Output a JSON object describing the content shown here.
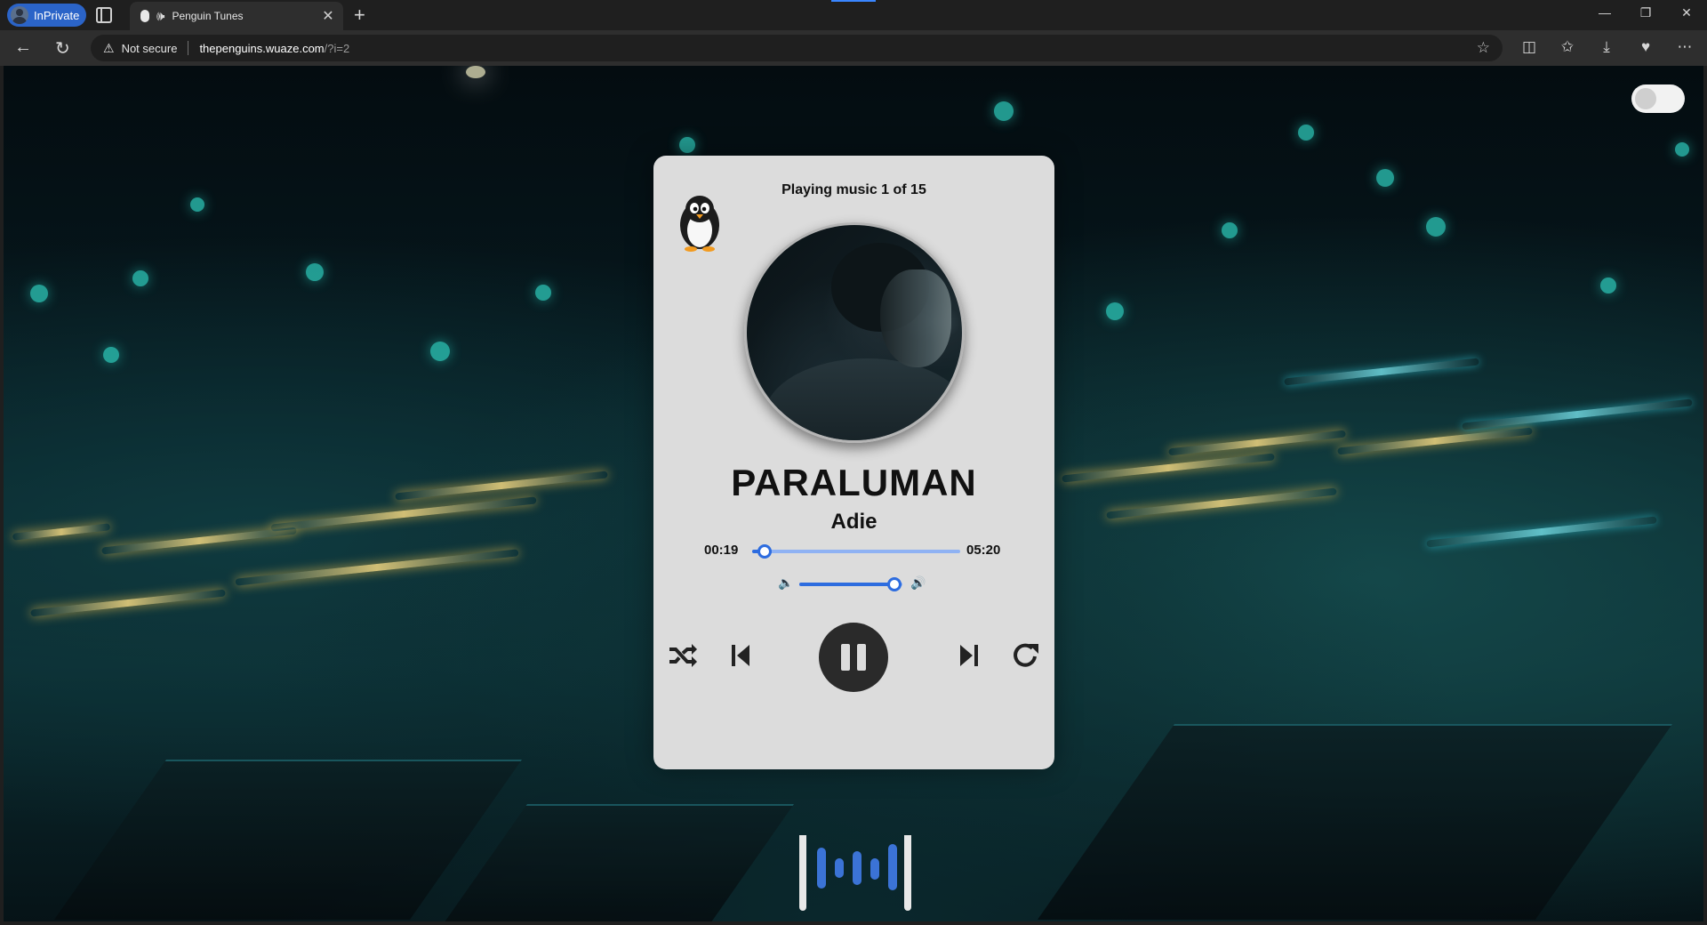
{
  "browser": {
    "profile_label": "InPrivate",
    "tab_title": "Penguin Tunes",
    "new_tab_glyph": "+",
    "security_label": "Not secure",
    "url_host": "thepenguins.wuaze.com",
    "url_path": "/?i=2"
  },
  "player": {
    "counter": "Playing music 1 of 15",
    "song_title": "PARALUMAN",
    "artist": "Adie",
    "current_time": "00:19",
    "duration": "05:20",
    "progress": 0.06,
    "volume": 0.92,
    "state": "playing",
    "accent_color": "#2d6cdf"
  },
  "theme_toggle": {
    "on": false
  },
  "icons": [
    "penguin-icon",
    "shuffle-icon",
    "previous-icon",
    "pause-icon",
    "next-icon",
    "repeat-icon",
    "volume-low-icon",
    "volume-high-icon"
  ]
}
